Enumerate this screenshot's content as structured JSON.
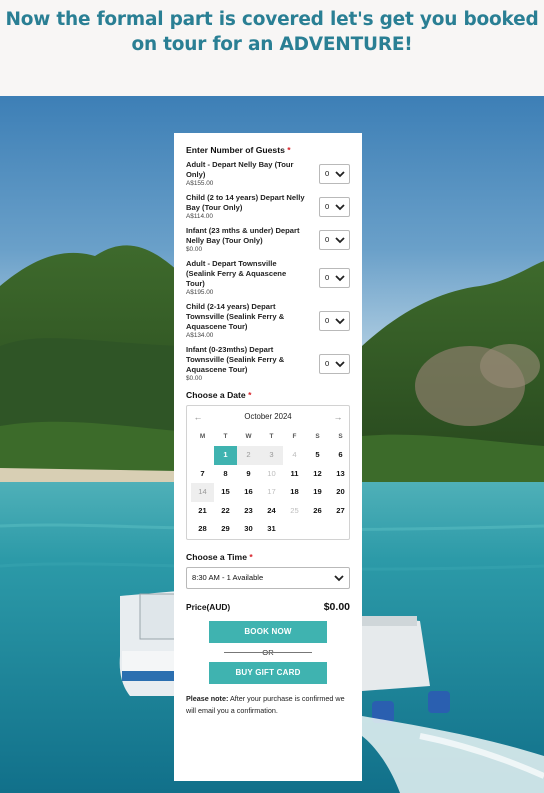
{
  "headline": "Now the formal part is covered let's get you booked on tour for an ADVENTURE!",
  "guests": {
    "label": "Enter Number of Guests",
    "required_mark": "*",
    "items": [
      {
        "name": "Adult - Depart Nelly Bay (Tour Only)",
        "price": "A$155.00",
        "qty": "0"
      },
      {
        "name": "Child (2 to 14 years) Depart Nelly Bay (Tour Only)",
        "price": "A$114.00",
        "qty": "0"
      },
      {
        "name": "Infant (23 mths & under) Depart Nelly Bay (Tour Only)",
        "price": "$0.00",
        "qty": "0"
      },
      {
        "name": "Adult - Depart Townsville (Sealink Ferry & Aquascene Tour)",
        "price": "A$195.00",
        "qty": "0"
      },
      {
        "name": "Child (2-14 years) Depart Townsville (Sealink Ferry & Aquascene Tour)",
        "price": "A$134.00",
        "qty": "0"
      },
      {
        "name": "Infant (0-23mths) Depart Townsville (Sealink Ferry & Aquascene Tour)",
        "price": "$0.00",
        "qty": "0"
      }
    ]
  },
  "date": {
    "label": "Choose a Date",
    "required_mark": "*",
    "month": "October 2024",
    "weekdays": [
      "M",
      "T",
      "W",
      "T",
      "F",
      "S",
      "S"
    ],
    "leading_blanks": 0,
    "days": [
      {
        "d": "",
        "s": "blank"
      },
      {
        "d": "1",
        "s": "today"
      },
      {
        "d": "2",
        "s": "muted"
      },
      {
        "d": "3",
        "s": "muted"
      },
      {
        "d": "4",
        "s": "past"
      },
      {
        "d": "5",
        "s": "open"
      },
      {
        "d": "6",
        "s": "open"
      },
      {
        "d": "7",
        "s": "open"
      },
      {
        "d": "8",
        "s": "open"
      },
      {
        "d": "9",
        "s": "open"
      },
      {
        "d": "10",
        "s": "past"
      },
      {
        "d": "11",
        "s": "open"
      },
      {
        "d": "12",
        "s": "open"
      },
      {
        "d": "13",
        "s": "open"
      },
      {
        "d": "14",
        "s": "muted"
      },
      {
        "d": "15",
        "s": "open"
      },
      {
        "d": "16",
        "s": "open"
      },
      {
        "d": "17",
        "s": "past"
      },
      {
        "d": "18",
        "s": "open"
      },
      {
        "d": "19",
        "s": "open"
      },
      {
        "d": "20",
        "s": "open"
      },
      {
        "d": "21",
        "s": "open"
      },
      {
        "d": "22",
        "s": "open"
      },
      {
        "d": "23",
        "s": "open"
      },
      {
        "d": "24",
        "s": "open"
      },
      {
        "d": "25",
        "s": "past"
      },
      {
        "d": "26",
        "s": "open"
      },
      {
        "d": "27",
        "s": "open"
      },
      {
        "d": "28",
        "s": "open"
      },
      {
        "d": "29",
        "s": "open"
      },
      {
        "d": "30",
        "s": "open"
      },
      {
        "d": "31",
        "s": "open"
      }
    ],
    "prev_icon": "arrow-left-icon",
    "next_icon": "arrow-right-icon"
  },
  "time": {
    "label": "Choose a Time",
    "required_mark": "*",
    "selected": "8:30 AM - 1 Available"
  },
  "price": {
    "label": "Price(AUD)",
    "value": "$0.00"
  },
  "buttons": {
    "book": "BOOK NOW",
    "or": "OR",
    "gift": "BUY GIFT CARD"
  },
  "note": {
    "bold": "Please note:",
    "text": " After your purchase is confirmed we will email you a confirmation."
  },
  "colors": {
    "headline": "#2a7f94",
    "accent": "#3fb3b0",
    "required": "#d8232a"
  }
}
